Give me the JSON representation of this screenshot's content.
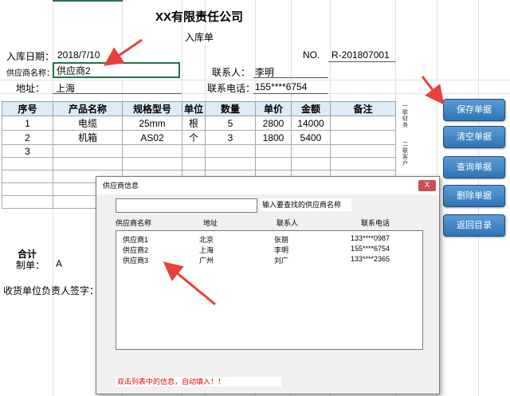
{
  "form": {
    "company_title": "XX有限责任公司",
    "doc_title": "入库单",
    "date_label": "入库日期：",
    "date_value": "2018/7/10",
    "no_label": "NO.",
    "no_value": "R-201807001",
    "supplier_label": "供应商名称：",
    "supplier_value": "供应商2",
    "contact_label": "联系人：",
    "contact_value": "李明",
    "address_label": "地址：",
    "address_value": "上海",
    "phone_label": "联系电话：",
    "phone_value": "155****6754"
  },
  "table": {
    "headers": [
      "序号",
      "产品名称",
      "规格型号",
      "单位",
      "数量",
      "单价",
      "金额",
      "备注"
    ],
    "rows": [
      [
        "1",
        "电缆",
        "25mm",
        "根",
        "5",
        "2800",
        "14000",
        ""
      ],
      [
        "2",
        "机箱",
        "AS02",
        "个",
        "3",
        "1800",
        "5400",
        ""
      ],
      [
        "3",
        "",
        "",
        "",
        "",
        "",
        "",
        ""
      ]
    ]
  },
  "side_notes": [
    "一联财务",
    "二联客户"
  ],
  "footer": {
    "total_label": "合计",
    "maker_label": "制单：",
    "maker_value": "A",
    "signature_label": "收货单位负责人签字："
  },
  "buttons": {
    "save": "保存单据",
    "clear": "清空单据",
    "query": "查询单据",
    "delete": "删除单据",
    "back": "返回目录"
  },
  "dialog": {
    "title": "供应商信息",
    "close_label": "X",
    "search_hint": "输入要查找的供应商名称",
    "columns": [
      "供应商名称",
      "地址",
      "联系人",
      "联系电话"
    ],
    "rows": [
      [
        "供应商1",
        "北京",
        "张丽",
        "133****0987"
      ],
      [
        "供应商2",
        "上海",
        "李明",
        "155****6754"
      ],
      [
        "供应商3",
        "广州",
        "刘广",
        "133****2365"
      ]
    ],
    "note": "双击列表中的信息，自动填入！！"
  },
  "colors": {
    "header_fill": "#ddebf7",
    "button_fill": "#2e75b6",
    "annotation_arrow": "#e8413a",
    "note_text": "#e60000",
    "selected_cell_border": "#217346"
  }
}
